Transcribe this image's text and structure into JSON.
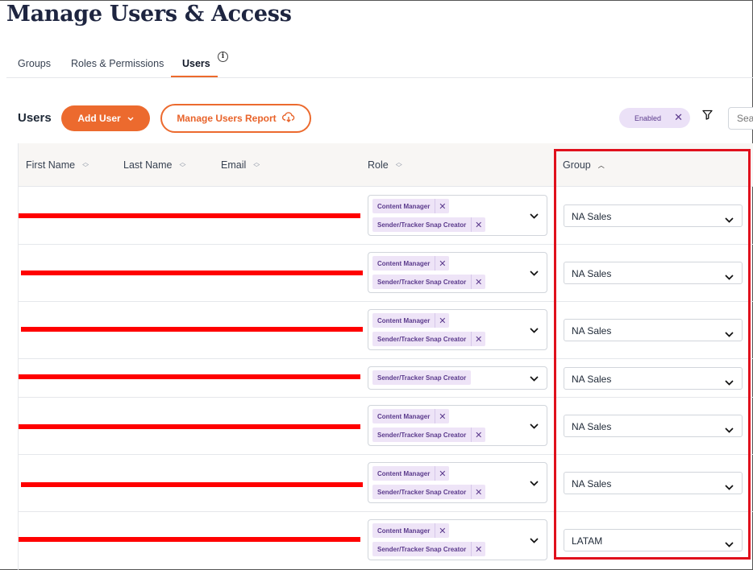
{
  "page": {
    "title": "Manage Users & Access"
  },
  "tabs": [
    {
      "label": "Groups"
    },
    {
      "label": "Roles & Permissions"
    },
    {
      "label": "Users"
    }
  ],
  "toolbar": {
    "section_title": "Users",
    "add_user_label": "Add User",
    "report_label": "Manage Users Report",
    "filter_chip_label": "Enabled",
    "search_placeholder": "Sea"
  },
  "table": {
    "columns": [
      "First Name",
      "Last Name",
      "Email",
      "Role",
      "Group"
    ],
    "rows": [
      {
        "roles": [
          "Content Manager",
          "Sender/Tracker Snap Creator"
        ],
        "group": "NA Sales"
      },
      {
        "roles": [
          "Content Manager",
          "Sender/Tracker Snap Creator"
        ],
        "group": "NA Sales"
      },
      {
        "roles": [
          "Content Manager",
          "Sender/Tracker Snap Creator"
        ],
        "group": "NA Sales"
      },
      {
        "roles": [
          "Sender/Tracker Snap Creator"
        ],
        "group": "NA Sales"
      },
      {
        "roles": [
          "Content Manager",
          "Sender/Tracker Snap Creator"
        ],
        "group": "NA Sales"
      },
      {
        "roles": [
          "Content Manager",
          "Sender/Tracker Snap Creator"
        ],
        "group": "NA Sales"
      },
      {
        "roles": [
          "Content Manager",
          "Sender/Tracker Snap Creator"
        ],
        "group": "LATAM"
      }
    ]
  },
  "colors": {
    "accent": "#ec6a2e",
    "tag_bg": "#eee4f7",
    "tag_text": "#5b3a8c",
    "redaction": "#ff0000",
    "highlight": "#e0101c",
    "title": "#1e2540"
  },
  "icons": [
    "info-icon",
    "chevron-down-icon",
    "cloud-download-icon",
    "close-icon",
    "filter-icon",
    "sort-icon"
  ]
}
